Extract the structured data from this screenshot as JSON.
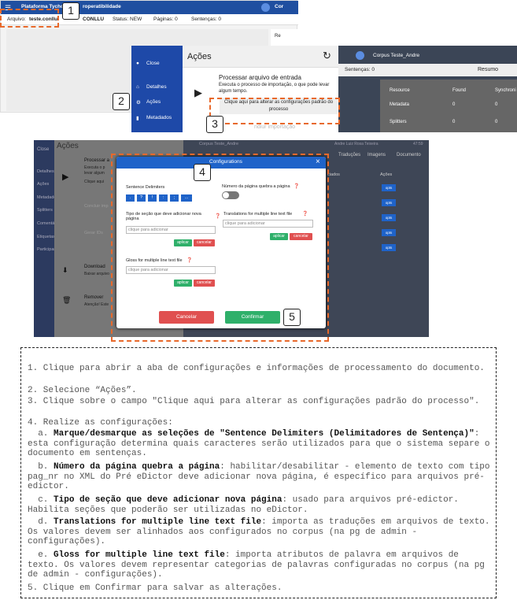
{
  "p1": {
    "title": "Plataforma Tycho B",
    "title2": "roperatibilidade",
    "corner": "Cor",
    "arquivo_label": "Arquivo:",
    "arquivo_value": "teste.conllu",
    "format": "CONLLU",
    "status": "Status: NEW",
    "paginas": "Páginas: 0",
    "sentencas": "Sentenças: 0",
    "res": "Re"
  },
  "p2": {
    "close": "Close",
    "detalhes": "Detalhes",
    "acoes": "Ações",
    "metadados": "Metadados",
    "heading": "Ações",
    "proc_title": "Processar arquivo de entrada",
    "proc_desc": "Executa o processo de importação, o que pode levar algum tempo.",
    "proc_link": "Clique aqui para alterar as configurações padrão do processo",
    "cut": "ndiur importação",
    "corpus": "Corpus Teste_Andre",
    "sentencas": "Sentenças: 0",
    "resumo": "Resumo",
    "col_resource": "Resource",
    "col_found": "Found",
    "col_sync": "Synchroni",
    "row1": "Metadata",
    "row1_found": "0",
    "row1_sync": "0",
    "row2": "Splitters",
    "row2_found": "0",
    "row2_sync": "0"
  },
  "p3": {
    "close": "Close",
    "side": [
      "Detalhes",
      "Ações",
      "Metadados",
      "Splitters",
      "Comentários",
      "Etiquetas",
      "Participantes"
    ],
    "heading": "Ações",
    "proc": "Processar a",
    "proc_d": "Executa o p",
    "proc_d2": "levar algum",
    "proc_link": "Clique aqui",
    "concluir": "Concluir imp",
    "gerar": "Gerar IDs",
    "download": "Download",
    "baixar": "Baixar arquivo",
    "remover": "Remover",
    "atencao": "Atenção! Este",
    "corpus": "Corpus Teste_Andre",
    "user": "Andre Luiz Rosa Teixeira",
    "time": "47:59",
    "tabs": [
      "Traduções",
      "Imagens",
      "Documento"
    ],
    "cols": [
      "ciados",
      "Ações"
    ],
    "opt": "opts"
  },
  "modal": {
    "title": "Configurations",
    "sd_label": "Sentence Delimiters",
    "sd_items": [
      ".",
      "?",
      "!",
      ":",
      ";",
      "…"
    ],
    "np_label": "Número da página quebra a página",
    "tipo_label": "Tipo de seção que deve adicionar nova página",
    "tipo_ph": "clique para adicionar",
    "trans_label": "Translations for multiple line text file",
    "trans_ph": "clique para adicionar",
    "gloss_label": "Gloss for multiple line text file",
    "gloss_ph": "clique para adicionar",
    "aplicar": "aplicar",
    "cancelar": "cancelar",
    "btn_cancel": "Cancelar",
    "btn_confirm": "Confirmar"
  },
  "nums": [
    "1",
    "2",
    "3",
    "4",
    "5"
  ],
  "instructions": {
    "l1": "1. Clique para abrir a aba de configurações e informações de processamento do documento.",
    "l2": "2. Selecione “Ações”.",
    "l3": "3. Clique sobre o campo \"Clique aqui para alterar as configurações padrão do processo\".",
    "l4": "4. Realize as configurações:",
    "a_b": "Marque/desmarque as seleções de \"Sentence Delimiters (Delimitadores de Sentença)\"",
    "a_t": ": esta configuração determina quais caracteres serão utilizados para que o sistema separe o documento em sentenças.",
    "b_b": "Número da página quebra a página",
    "b_t": ": habilitar/desabilitar - elemento de texto com tipo pag_nr no XML do Pré eDictor deve adicionar nova página, é específico para arquivos pré-edictor.",
    "c_b": "Tipo de seção que deve adicionar nova página",
    "c_t": ": usado para arquivos pré-edictor. Habilita seções que poderão ser utilizadas no eDictor.",
    "d_b": "Translations for multiple line text file",
    "d_t": ": importa as traduções em arquivos de texto. Os valores devem ser alinhados aos configurados no corpus (na pg de admin - configurações).",
    "e_b": "Gloss for multiple line text file",
    "e_t": ": importa atributos de palavra em arquivos de texto. Os valores devem representar categorias de palavras configuradas no corpus (na pg de admin - configurações).",
    "l5": "5. Clique em Confirmar para salvar as alterações."
  }
}
